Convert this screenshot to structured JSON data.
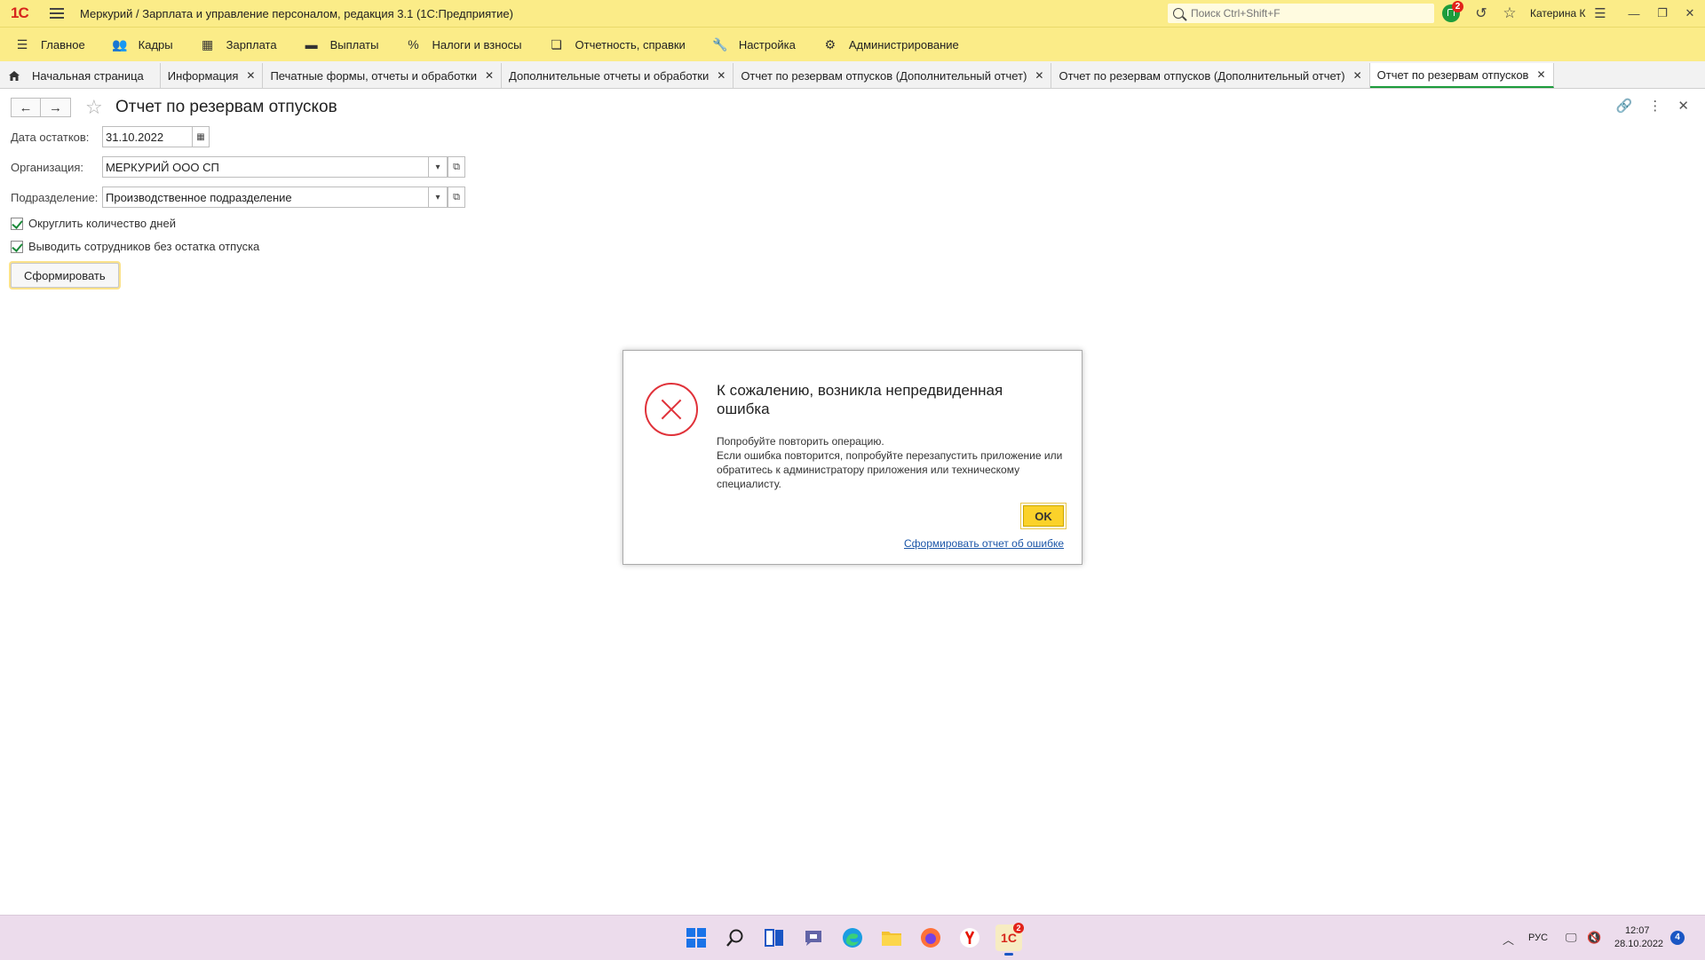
{
  "window": {
    "logo": "1С",
    "title": "Меркурий / Зарплата и управление персоналом, редакция 3.1  (1С:Предприятие)",
    "search_placeholder": "Поиск Ctrl+Shift+F",
    "notifications_count": "2",
    "user_name": "Катерина К"
  },
  "sections": [
    {
      "label": "Главное",
      "icon": "menu-lines-icon"
    },
    {
      "label": "Кадры",
      "icon": "people-icon"
    },
    {
      "label": "Зарплата",
      "icon": "calculator-icon"
    },
    {
      "label": "Выплаты",
      "icon": "wallet-icon"
    },
    {
      "label": "Налоги и взносы",
      "icon": "percent-icon"
    },
    {
      "label": "Отчетность, справки",
      "icon": "documents-icon"
    },
    {
      "label": "Настройка",
      "icon": "wrench-icon"
    },
    {
      "label": "Администрирование",
      "icon": "gear-icon"
    }
  ],
  "tabs": [
    {
      "label": "Начальная страница"
    },
    {
      "label": "Информация"
    },
    {
      "label": "Печатные формы, отчеты и обработки"
    },
    {
      "label": "Дополнительные отчеты и обработки"
    },
    {
      "label": "Отчет по резервам отпусков (Дополнительный отчет)"
    },
    {
      "label": "Отчет по резервам отпусков (Дополнительный отчет)"
    },
    {
      "label": "Отчет по резервам отпусков"
    }
  ],
  "form": {
    "title": "Отчет по резервам отпусков",
    "date_label": "Дата остатков:",
    "date_value": "31.10.2022",
    "org_label": "Организация:",
    "org_value": "МЕРКУРИЙ ООО СП",
    "dept_label": "Подразделение:",
    "dept_value": "Производственное подразделение",
    "round_days_label": "Округлить количество дней",
    "show_no_balance_label": "Выводить сотрудников без остатка отпуска",
    "generate_button": "Сформировать"
  },
  "dialog": {
    "title": "К сожалению, возникла непредвиденная ошибка",
    "line1": "Попробуйте повторить операцию.",
    "line2": "Если ошибка повторится, попробуйте перезапустить приложение или обратитесь к администратору приложения или техническому специалисту.",
    "ok_button": "OK",
    "report_link": "Сформировать отчет об ошибке"
  },
  "taskbar": {
    "app_badge": "2",
    "language": "РУС",
    "time": "12:07",
    "date": "28.10.2022",
    "notifications": "4"
  },
  "colors": {
    "brand_yellow": "#fbec88",
    "active_tab_accent": "#1d9c3c",
    "error_red": "#e0323a",
    "ok_button": "#fbd22a"
  }
}
